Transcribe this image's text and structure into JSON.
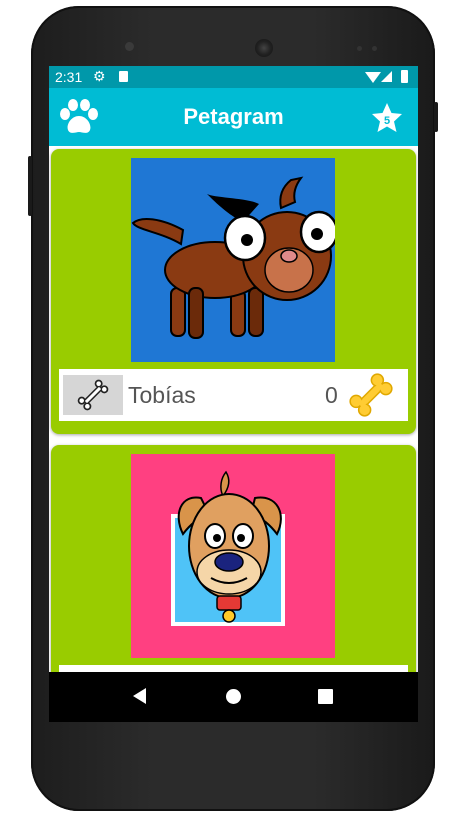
{
  "status_bar": {
    "time": "2:31",
    "icons": [
      "gear-icon",
      "sd-card-icon",
      "wifi-icon",
      "signal-icon",
      "battery-icon"
    ]
  },
  "app_bar": {
    "title": "Petagram",
    "left_icon": "paw-icon",
    "right_icon": "star-icon",
    "favorites_count": "5"
  },
  "pets": [
    {
      "name": "Tobías",
      "likes": "0",
      "photo": "cartoon-brown-dog",
      "photo_bg": "#1f77d4"
    },
    {
      "name": "",
      "likes": "",
      "photo": "cartoon-tan-dog",
      "photo_bg": "#ff4081"
    }
  ],
  "colors": {
    "status_bar": "#0098aa",
    "app_bar": "#00bcd4",
    "card": "#99cc00",
    "rate_icon": "#ffcc33"
  },
  "nav_bar": {
    "buttons": [
      "back-button",
      "home-button",
      "recents-button"
    ]
  }
}
